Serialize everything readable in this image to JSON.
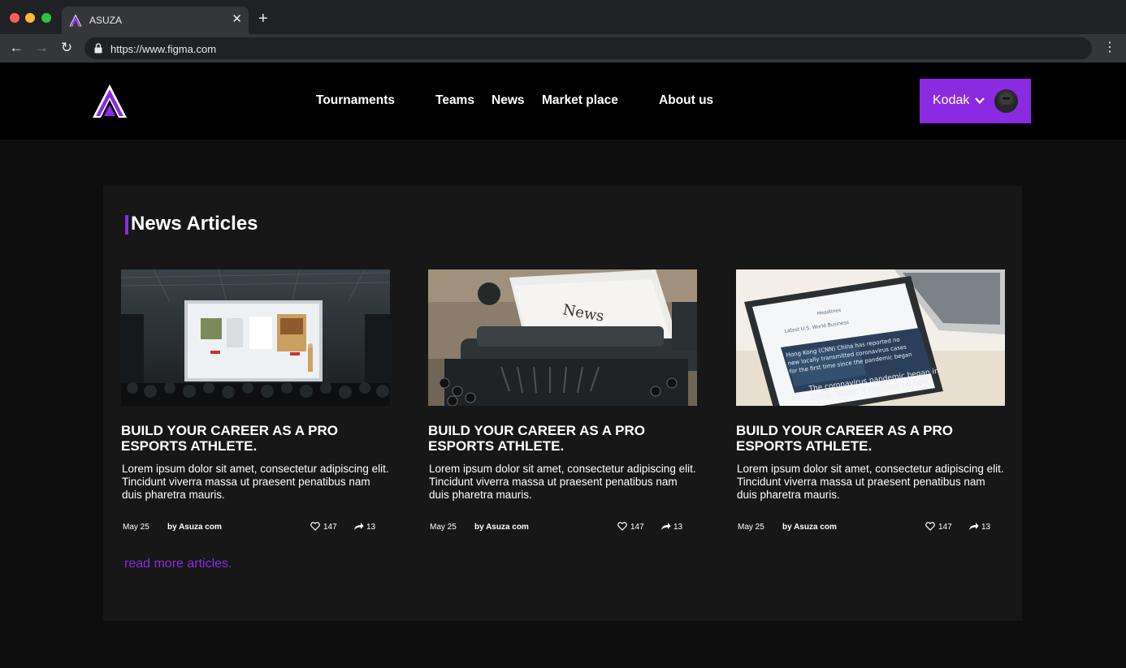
{
  "browser": {
    "tab_title": "ASUZA",
    "tab_close": "✕",
    "new_tab": "+",
    "url": "https://www.figma.com",
    "back": "←",
    "forward": "→",
    "reload": "↻",
    "menu": "⋮"
  },
  "header": {
    "nav": [
      "Tournaments",
      "Teams",
      "News",
      "Market place",
      "About us"
    ],
    "user_name": "Kodak"
  },
  "section": {
    "title": "News Articles",
    "read_more": "read more articles."
  },
  "articles": [
    {
      "image": "conference-stage-photo",
      "title": "BUILD YOUR CAREER AS A PRO ESPORTS ATHLETE.",
      "text": "Lorem ipsum dolor sit amet, consectetur adipiscing elit. Tincidunt viverra massa ut praesent penatibus nam duis pharetra mauris.",
      "date": "May 25",
      "author": "by Asuza com",
      "likes": "147",
      "shares": "13"
    },
    {
      "image": "typewriter-news-photo",
      "title": "BUILD YOUR CAREER AS A PRO ESPORTS ATHLETE.",
      "text": "Lorem ipsum dolor sit amet, consectetur adipiscing elit. Tincidunt viverra massa ut praesent penatibus nam duis pharetra mauris.",
      "date": "May 25",
      "author": "by Asuza com",
      "likes": "147",
      "shares": "13"
    },
    {
      "image": "phone-news-app-photo",
      "title": "BUILD YOUR CAREER AS A PRO ESPORTS ATHLETE.",
      "text": "Lorem ipsum dolor sit amet, consectetur adipiscing elit. Tincidunt viverra massa ut praesent penatibus nam duis pharetra mauris.",
      "date": "May 25",
      "author": "by Asuza com",
      "likes": "147",
      "shares": "13"
    }
  ],
  "colors": {
    "accent": "#8a2be2",
    "page_bg": "#0e0e0e",
    "panel_bg": "#171717",
    "header_bg": "#000000"
  }
}
